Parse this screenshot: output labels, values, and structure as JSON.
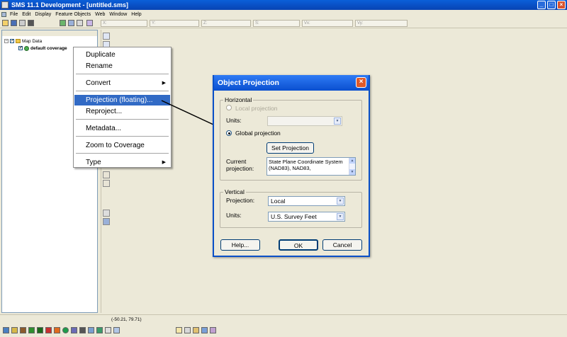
{
  "window": {
    "title": "SMS 11.1 Development - [untitled.sms]"
  },
  "menubar": {
    "items": [
      "File",
      "Edit",
      "Display",
      "Feature Objects",
      "Web",
      "Window",
      "Help"
    ]
  },
  "toolbar": {
    "coord_labels": [
      "X:",
      "Y:",
      "Z:",
      "S:",
      "Vx:",
      "Vy:"
    ]
  },
  "explorer": {
    "root_label": "Map Data",
    "coverage_label": "default coverage"
  },
  "context_menu": {
    "items": [
      "Duplicate",
      "Rename",
      "Convert",
      "Projection (floating)...",
      "Reproject...",
      "Metadata...",
      "Zoom to Coverage",
      "Type"
    ],
    "highlighted": "Projection (floating)..."
  },
  "dialog": {
    "title": "Object Projection",
    "horizontal": {
      "group_label": "Horizontal",
      "local_projection_label": "Local projection",
      "units_label": "Units:",
      "units_value": "",
      "global_projection_label": "Global projection",
      "selected": "Global projection",
      "set_projection_button": "Set Projection",
      "current_projection_label_line1": "Current",
      "current_projection_label_line2": "projection:",
      "current_projection_value": "State Plane Coordinate System (NAD83), NAD83,"
    },
    "vertical": {
      "group_label": "Vertical",
      "projection_label": "Projection:",
      "projection_value": "Local",
      "units_label": "Units:",
      "units_value": "U.S. Survey Feet"
    },
    "buttons": {
      "help": "Help...",
      "ok": "OK",
      "cancel": "Cancel"
    }
  },
  "statusbar": {
    "coordinates": "(-50.21, 79.71)"
  },
  "colors": {
    "titlebar": "#0a50c8",
    "highlight": "#316ac5",
    "window_bg": "#ece9d8",
    "close_button": "#e05a2a"
  }
}
